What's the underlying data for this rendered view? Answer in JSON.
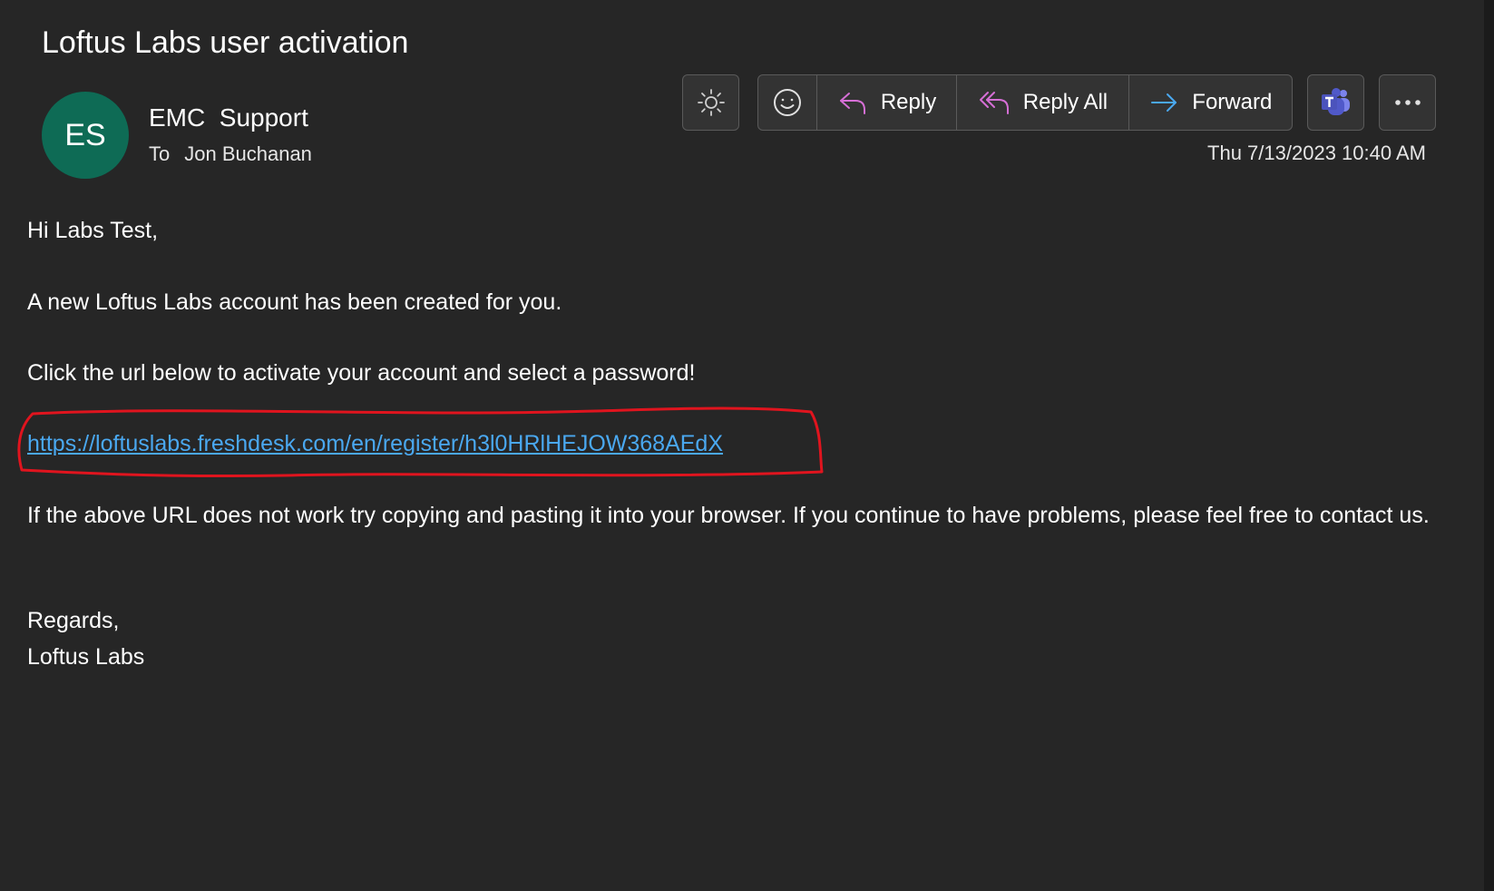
{
  "email": {
    "subject": "Loftus Labs user activation",
    "avatar_initials": "ES",
    "sender_name": "EMC  Support",
    "to_label": "To",
    "recipient": "Jon Buchanan",
    "date": "Thu 7/13/2023 10:40 AM"
  },
  "toolbar": {
    "reply_label": "Reply",
    "reply_all_label": "Reply All",
    "forward_label": "Forward",
    "icons": {
      "theme": "sun-icon",
      "react": "smiley-icon",
      "reply": "reply-arrow-icon",
      "reply_all": "reply-all-arrow-icon",
      "forward": "forward-arrow-icon",
      "teams": "teams-icon",
      "more": "more-dots-icon"
    }
  },
  "body": {
    "greeting": "Hi Labs Test,",
    "line1": "A new Loftus Labs account has been created for you.",
    "line2": "Click the url below to activate your account and select a password!",
    "link": "https://loftuslabs.freshdesk.com/en/register/h3l0HRlHEJOW368AEdX",
    "line3": "If the above URL does not work try copying and pasting it into your browser. If you continue to have problems, please feel free to contact us.",
    "closing": "Regards,",
    "signature": "Loftus Labs"
  },
  "colors": {
    "background": "#262626",
    "avatar": "#0e6b55",
    "link": "#4aa8f0",
    "reply_icon": "#d66fd6",
    "forward_icon": "#4aa8f0",
    "annotation": "#e0141e"
  }
}
